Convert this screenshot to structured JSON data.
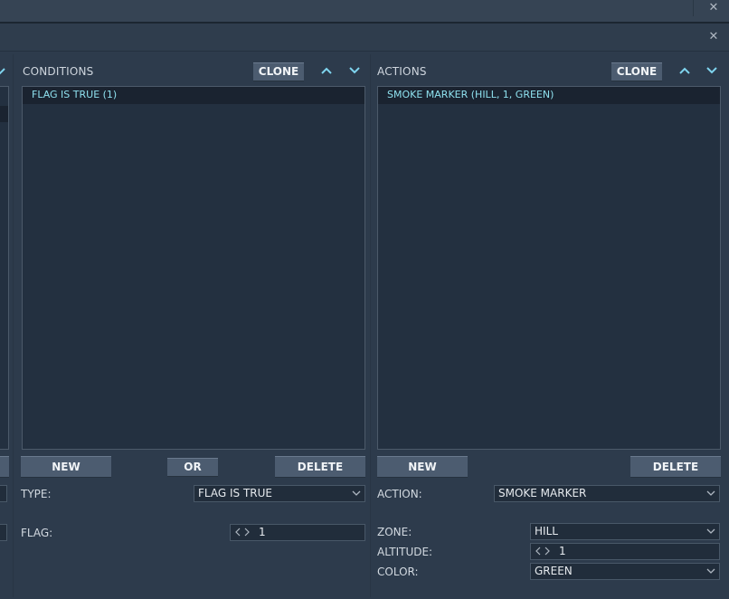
{
  "conditions": {
    "title": "CONDITIONS",
    "clone_label": "CLONE",
    "items": [
      "FLAG IS TRUE (1)"
    ],
    "new_label": "NEW",
    "or_label": "OR",
    "delete_label": "DELETE",
    "type_label": "TYPE:",
    "type_value": "FLAG IS TRUE",
    "flag_label": "FLAG:",
    "flag_value": "1"
  },
  "actions": {
    "title": "ACTIONS",
    "clone_label": "CLONE",
    "items": [
      "SMOKE MARKER (HILL, 1, GREEN)"
    ],
    "new_label": "NEW",
    "delete_label": "DELETE",
    "action_label": "ACTION:",
    "action_value": "SMOKE MARKER",
    "zone_label": "ZONE:",
    "zone_value": "HILL",
    "altitude_label": "ALTITUDE:",
    "altitude_value": "1",
    "color_label": "COLOR:",
    "color_value": "GREEN"
  },
  "icons": {
    "close": "close-icon",
    "up": "chevron-up-icon",
    "down": "chevron-down-icon",
    "dropdown": "chevron-down-icon",
    "spinner": "spinner-arrows-icon"
  },
  "colors": {
    "background": "#2d3b4c",
    "list_background": "#233040",
    "selected_text": "#8ee0ee",
    "accent_arrow": "#7fd4ee",
    "button": "#4c5c70"
  }
}
